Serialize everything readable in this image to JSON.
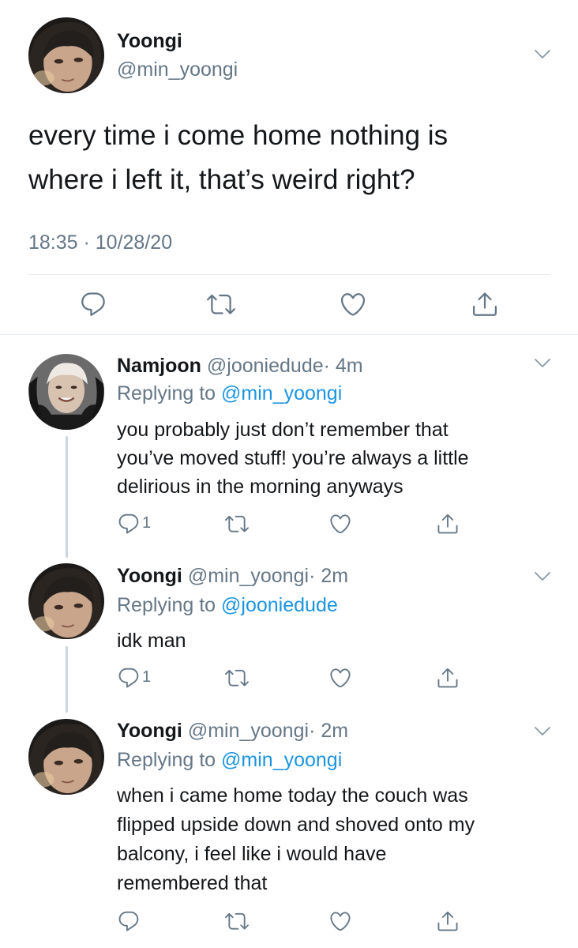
{
  "main_tweet": {
    "author": "Yoongi",
    "handle": "@min_yoongi",
    "text_lines": [
      "every time i come home nothing is",
      "where i left it, that’s weird right?"
    ],
    "timestamp": "18:35 · 10/28/20"
  },
  "replies": [
    {
      "author": "Namjoon",
      "handle": "@jooniedude",
      "time": "· 4m",
      "replying_prefix": "Replying to ",
      "replying_to": "@min_yoongi",
      "text_lines": [
        "you probably just don’t remember that",
        "you’ve moved stuff! you’re always a little",
        "delirious in the morning anyways"
      ],
      "reply_count": "1"
    },
    {
      "author": "Yoongi",
      "handle": "@min_yoongi",
      "time": "· 2m",
      "replying_prefix": "Replying to ",
      "replying_to": "@jooniedude",
      "text_lines": [
        "idk man"
      ],
      "reply_count": "1"
    },
    {
      "author": "Yoongi",
      "handle": "@min_yoongi",
      "time": "· 2m",
      "replying_prefix": "Replying to ",
      "replying_to": "@min_yoongi",
      "text_lines": [
        "when i came home today the couch was",
        "flipped upside down and shoved onto my",
        "balcony, i feel like i would have",
        "remembered that"
      ],
      "reply_count": ""
    }
  ],
  "icons": {
    "reply": "reply-icon",
    "retweet": "retweet-icon",
    "like": "like-icon",
    "share": "share-icon",
    "more": "chevron-down-icon"
  },
  "colors": {
    "link": "#1b95e0",
    "secondary": "#657786",
    "primary_text": "#14171a",
    "divider": "#e6ecf0"
  }
}
